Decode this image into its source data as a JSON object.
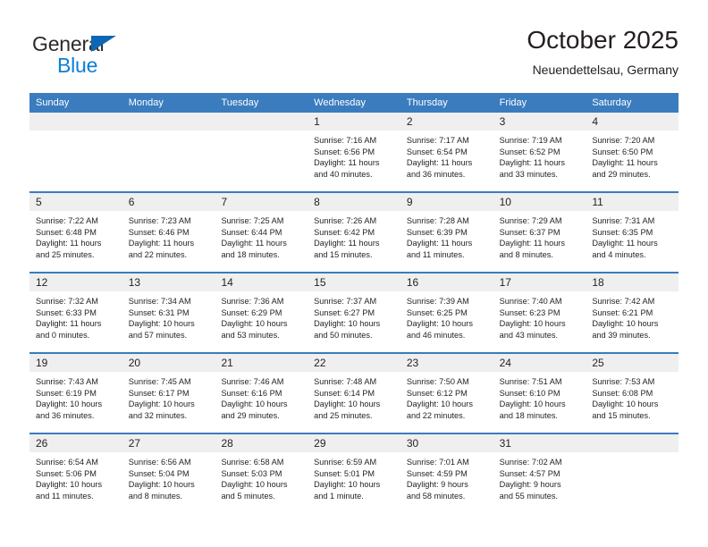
{
  "brand": {
    "name_top": "General",
    "name_bottom": "Blue",
    "flag_color": "#0c68b4",
    "blue_color": "#0c7fd4"
  },
  "header": {
    "title": "October 2025",
    "subtitle": "Neuendettelsau, Germany"
  },
  "theme": {
    "header_blue": "#3a7cbe",
    "day_band_gray": "#efefef",
    "text": "#231f20"
  },
  "weekdays": [
    "Sunday",
    "Monday",
    "Tuesday",
    "Wednesday",
    "Thursday",
    "Friday",
    "Saturday"
  ],
  "weeks": [
    [
      {
        "day": "",
        "lines": []
      },
      {
        "day": "",
        "lines": []
      },
      {
        "day": "",
        "lines": []
      },
      {
        "day": "1",
        "lines": [
          "Sunrise: 7:16 AM",
          "Sunset: 6:56 PM",
          "Daylight: 11 hours",
          "and 40 minutes."
        ]
      },
      {
        "day": "2",
        "lines": [
          "Sunrise: 7:17 AM",
          "Sunset: 6:54 PM",
          "Daylight: 11 hours",
          "and 36 minutes."
        ]
      },
      {
        "day": "3",
        "lines": [
          "Sunrise: 7:19 AM",
          "Sunset: 6:52 PM",
          "Daylight: 11 hours",
          "and 33 minutes."
        ]
      },
      {
        "day": "4",
        "lines": [
          "Sunrise: 7:20 AM",
          "Sunset: 6:50 PM",
          "Daylight: 11 hours",
          "and 29 minutes."
        ]
      }
    ],
    [
      {
        "day": "5",
        "lines": [
          "Sunrise: 7:22 AM",
          "Sunset: 6:48 PM",
          "Daylight: 11 hours",
          "and 25 minutes."
        ]
      },
      {
        "day": "6",
        "lines": [
          "Sunrise: 7:23 AM",
          "Sunset: 6:46 PM",
          "Daylight: 11 hours",
          "and 22 minutes."
        ]
      },
      {
        "day": "7",
        "lines": [
          "Sunrise: 7:25 AM",
          "Sunset: 6:44 PM",
          "Daylight: 11 hours",
          "and 18 minutes."
        ]
      },
      {
        "day": "8",
        "lines": [
          "Sunrise: 7:26 AM",
          "Sunset: 6:42 PM",
          "Daylight: 11 hours",
          "and 15 minutes."
        ]
      },
      {
        "day": "9",
        "lines": [
          "Sunrise: 7:28 AM",
          "Sunset: 6:39 PM",
          "Daylight: 11 hours",
          "and 11 minutes."
        ]
      },
      {
        "day": "10",
        "lines": [
          "Sunrise: 7:29 AM",
          "Sunset: 6:37 PM",
          "Daylight: 11 hours",
          "and 8 minutes."
        ]
      },
      {
        "day": "11",
        "lines": [
          "Sunrise: 7:31 AM",
          "Sunset: 6:35 PM",
          "Daylight: 11 hours",
          "and 4 minutes."
        ]
      }
    ],
    [
      {
        "day": "12",
        "lines": [
          "Sunrise: 7:32 AM",
          "Sunset: 6:33 PM",
          "Daylight: 11 hours",
          "and 0 minutes."
        ]
      },
      {
        "day": "13",
        "lines": [
          "Sunrise: 7:34 AM",
          "Sunset: 6:31 PM",
          "Daylight: 10 hours",
          "and 57 minutes."
        ]
      },
      {
        "day": "14",
        "lines": [
          "Sunrise: 7:36 AM",
          "Sunset: 6:29 PM",
          "Daylight: 10 hours",
          "and 53 minutes."
        ]
      },
      {
        "day": "15",
        "lines": [
          "Sunrise: 7:37 AM",
          "Sunset: 6:27 PM",
          "Daylight: 10 hours",
          "and 50 minutes."
        ]
      },
      {
        "day": "16",
        "lines": [
          "Sunrise: 7:39 AM",
          "Sunset: 6:25 PM",
          "Daylight: 10 hours",
          "and 46 minutes."
        ]
      },
      {
        "day": "17",
        "lines": [
          "Sunrise: 7:40 AM",
          "Sunset: 6:23 PM",
          "Daylight: 10 hours",
          "and 43 minutes."
        ]
      },
      {
        "day": "18",
        "lines": [
          "Sunrise: 7:42 AM",
          "Sunset: 6:21 PM",
          "Daylight: 10 hours",
          "and 39 minutes."
        ]
      }
    ],
    [
      {
        "day": "19",
        "lines": [
          "Sunrise: 7:43 AM",
          "Sunset: 6:19 PM",
          "Daylight: 10 hours",
          "and 36 minutes."
        ]
      },
      {
        "day": "20",
        "lines": [
          "Sunrise: 7:45 AM",
          "Sunset: 6:17 PM",
          "Daylight: 10 hours",
          "and 32 minutes."
        ]
      },
      {
        "day": "21",
        "lines": [
          "Sunrise: 7:46 AM",
          "Sunset: 6:16 PM",
          "Daylight: 10 hours",
          "and 29 minutes."
        ]
      },
      {
        "day": "22",
        "lines": [
          "Sunrise: 7:48 AM",
          "Sunset: 6:14 PM",
          "Daylight: 10 hours",
          "and 25 minutes."
        ]
      },
      {
        "day": "23",
        "lines": [
          "Sunrise: 7:50 AM",
          "Sunset: 6:12 PM",
          "Daylight: 10 hours",
          "and 22 minutes."
        ]
      },
      {
        "day": "24",
        "lines": [
          "Sunrise: 7:51 AM",
          "Sunset: 6:10 PM",
          "Daylight: 10 hours",
          "and 18 minutes."
        ]
      },
      {
        "day": "25",
        "lines": [
          "Sunrise: 7:53 AM",
          "Sunset: 6:08 PM",
          "Daylight: 10 hours",
          "and 15 minutes."
        ]
      }
    ],
    [
      {
        "day": "26",
        "lines": [
          "Sunrise: 6:54 AM",
          "Sunset: 5:06 PM",
          "Daylight: 10 hours",
          "and 11 minutes."
        ]
      },
      {
        "day": "27",
        "lines": [
          "Sunrise: 6:56 AM",
          "Sunset: 5:04 PM",
          "Daylight: 10 hours",
          "and 8 minutes."
        ]
      },
      {
        "day": "28",
        "lines": [
          "Sunrise: 6:58 AM",
          "Sunset: 5:03 PM",
          "Daylight: 10 hours",
          "and 5 minutes."
        ]
      },
      {
        "day": "29",
        "lines": [
          "Sunrise: 6:59 AM",
          "Sunset: 5:01 PM",
          "Daylight: 10 hours",
          "and 1 minute."
        ]
      },
      {
        "day": "30",
        "lines": [
          "Sunrise: 7:01 AM",
          "Sunset: 4:59 PM",
          "Daylight: 9 hours",
          "and 58 minutes."
        ]
      },
      {
        "day": "31",
        "lines": [
          "Sunrise: 7:02 AM",
          "Sunset: 4:57 PM",
          "Daylight: 9 hours",
          "and 55 minutes."
        ]
      },
      {
        "day": "",
        "lines": []
      }
    ]
  ]
}
